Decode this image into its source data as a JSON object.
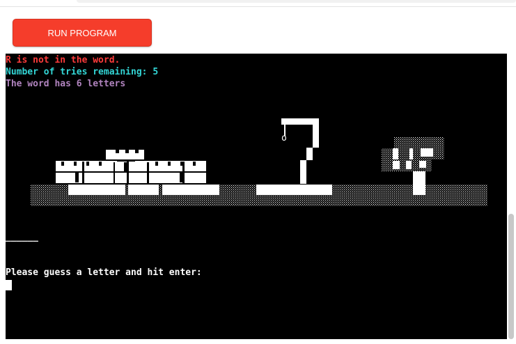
{
  "toolbar": {
    "run_label": "RUN PROGRAM"
  },
  "terminal": {
    "lines": [
      {
        "text": "R is not in the word.",
        "color": "#ff3b3b"
      },
      {
        "text": "Number of tries remaining: 5",
        "color": "#33d6d6"
      },
      {
        "text": "The word has 6 letters",
        "color": "#b184bf"
      }
    ],
    "hangman_head": "o",
    "word_blanks": "______",
    "prompt": "Please guess a letter and hit enter:"
  },
  "colors": {
    "button": "#f53d2b",
    "terminal_bg": "#000000",
    "ascii_art": "#ffffff"
  }
}
